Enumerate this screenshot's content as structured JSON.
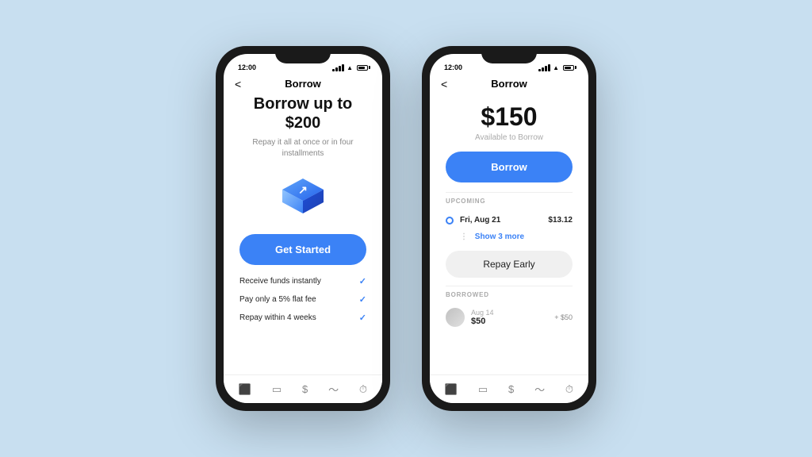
{
  "background_color": "#c8dff0",
  "phone1": {
    "status_time": "12:00",
    "nav_back": "<",
    "nav_title": "Borrow",
    "heading": "Borrow up to $200",
    "subtext": "Repay it all at once or in four installments",
    "get_started_btn": "Get Started",
    "features": [
      {
        "text": "Receive funds instantly",
        "check": true
      },
      {
        "text": "Pay only a 5% flat fee",
        "check": true
      },
      {
        "text": "Repay within 4 weeks",
        "check": true
      }
    ],
    "tabs": [
      "home",
      "card",
      "dollar",
      "chart",
      "clock"
    ]
  },
  "phone2": {
    "status_time": "12:00",
    "nav_back": "<",
    "nav_title": "Borrow",
    "amount": "$150",
    "amount_label": "Available to Borrow",
    "borrow_btn": "Borrow",
    "section_upcoming": "UPCOMING",
    "upcoming_date": "Fri, Aug 21",
    "upcoming_amount": "$13.12",
    "show_more": "Show 3 more",
    "repay_early_btn": "Repay Early",
    "section_borrowed": "BORROWED",
    "borrowed_date": "Aug 14",
    "borrowed_value": "$50",
    "borrowed_change": "+ $50",
    "tabs": [
      "home",
      "card",
      "dollar",
      "chart",
      "clock"
    ]
  }
}
